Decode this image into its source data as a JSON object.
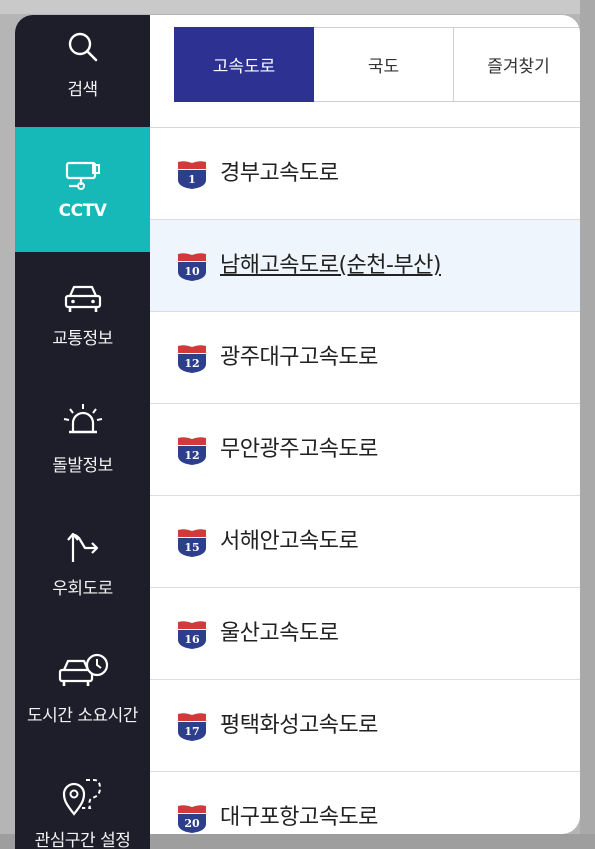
{
  "sidebar": {
    "items": [
      {
        "label": "검색",
        "icon": "search-icon"
      },
      {
        "label": "CCTV",
        "icon": "cctv-camera-icon",
        "active": true
      },
      {
        "label": "교통정보",
        "icon": "car-icon"
      },
      {
        "label": "돌발정보",
        "icon": "siren-icon"
      },
      {
        "label": "우회도로",
        "icon": "detour-arrow-icon"
      },
      {
        "label": "도시간 소요시간",
        "icon": "car-clock-icon"
      },
      {
        "label": "관심구간 설정",
        "icon": "route-pin-icon"
      }
    ]
  },
  "tabs": [
    {
      "label": "고속도로",
      "active": true
    },
    {
      "label": "국도"
    },
    {
      "label": "즐겨찾기"
    }
  ],
  "highways": [
    {
      "num": "1",
      "name": "경부고속도로"
    },
    {
      "num": "10",
      "name": "남해고속도로(순천-부산)",
      "selected": true
    },
    {
      "num": "12",
      "name": "광주대구고속도로"
    },
    {
      "num": "12",
      "name": "무안광주고속도로"
    },
    {
      "num": "15",
      "name": "서해안고속도로"
    },
    {
      "num": "16",
      "name": "울산고속도로"
    },
    {
      "num": "17",
      "name": "평택화성고속도로"
    },
    {
      "num": "20",
      "name": "대구포항고속도로"
    }
  ],
  "colors": {
    "sidebar_bg": "#1e1e2a",
    "active_accent": "#16b8b8",
    "tab_active": "#2d3192",
    "selected_row": "#eef5fd",
    "shield_blue": "#2c3e8c",
    "shield_red": "#d23a3a"
  }
}
